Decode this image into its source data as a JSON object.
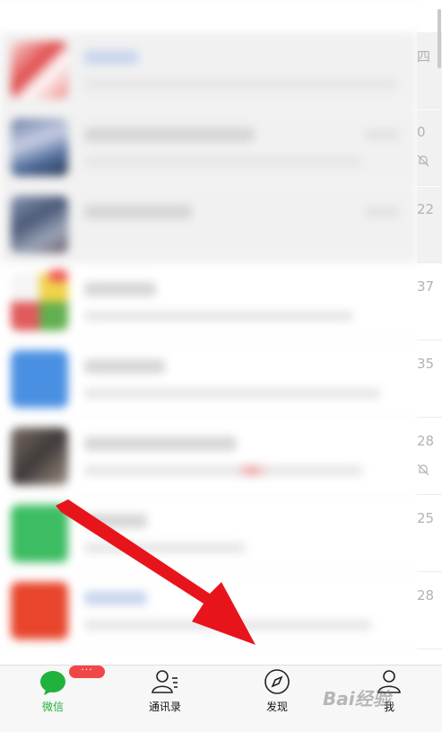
{
  "chat_list": {
    "times": [
      "四",
      "0",
      "22",
      "37",
      "35",
      "28",
      "25",
      "28"
    ]
  },
  "tabbar": {
    "tabs": [
      {
        "label": "微信",
        "icon": "chat-bubble-icon",
        "active": true,
        "badge": "···"
      },
      {
        "label": "通讯录",
        "icon": "contacts-icon"
      },
      {
        "label": "发现",
        "icon": "compass-icon"
      },
      {
        "label": "我",
        "icon": "person-icon"
      }
    ]
  },
  "watermark": {
    "text": "Bai经验"
  },
  "colors": {
    "accent": "#20b23d",
    "badge": "#f04848",
    "arrow": "#e8141c"
  }
}
